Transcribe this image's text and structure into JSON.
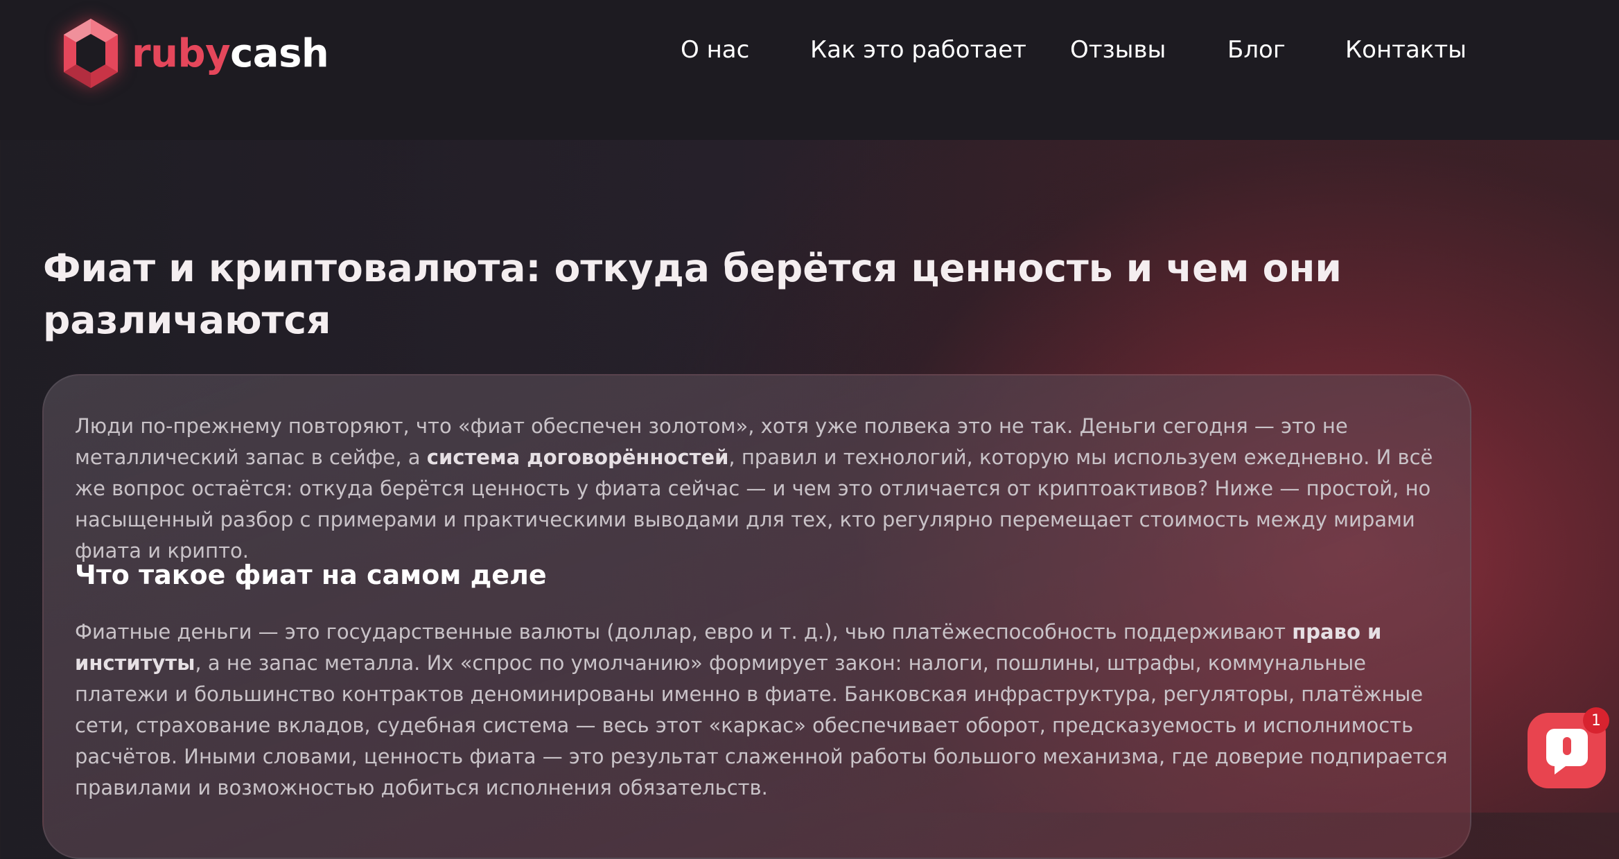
{
  "header": {
    "logo": {
      "part1": "ruby",
      "part2": "cash"
    },
    "nav": [
      "О нас",
      "Как это работает",
      "Отзывы",
      "Блог",
      "Контакты"
    ]
  },
  "article": {
    "title": "Фиат и криптовалюта: откуда берётся ценность и чем они различаются",
    "intro": {
      "before": "Люди по-прежнему повторяют, что «фиат обеспечен золотом», хотя уже полвека это не так. Деньги сегодня — это не металлический запас в сейфе, а ",
      "bold": "система договорённостей",
      "after": ", правил и технологий, которую мы используем ежедневно. И всё же вопрос остаётся: откуда берётся ценность у фиата сейчас — и чем это отличается от криптоактивов? Ниже — простой, но насыщенный разбор с примерами и практическими выводами для тех, кто регулярно перемещает стоимость между мирами фиата и крипто."
    },
    "section_heading": "Что такое фиат на самом деле",
    "section_para": {
      "before": "Фиатные деньги — это государственные валюты (доллар, евро и т. д.), чью платёжеспособность поддерживают ",
      "bold": "право и институты",
      "after": ", а не запас металла. Их «спрос по умолчанию» формирует закон: налоги, пошлины, штрафы, коммунальные платежи и большинство контрактов деноминированы именно в фиате. Банковская инфраструктура, регуляторы, платёжные сети, страхование вкладов, судебная система — весь этот «каркас» обеспечивает оборот, предсказуемость и исполнимость расчётов. Иными словами, ценность фиата — это результат слаженной работы большого механизма, где доверие подпирается правилами и возможностью добиться исполнения обязательств."
    }
  },
  "chat_widget": {
    "badge_count": "1",
    "icon": "chat-bubble-icon"
  },
  "colors": {
    "brand": "#e5475b",
    "header_bg": "#1d1b21",
    "chat": "#e8444f"
  }
}
